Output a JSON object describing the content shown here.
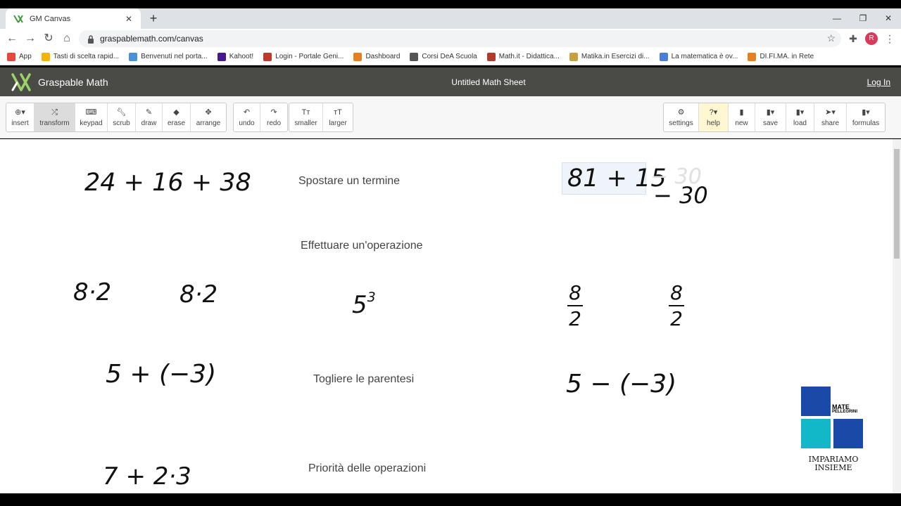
{
  "browser": {
    "tab_title": "GM Canvas",
    "url": "graspablemath.com/canvas",
    "avatar_letter": "R",
    "bookmarks": [
      "App",
      "Tasti di scelta rapid...",
      "Benvenuti nel porta...",
      "Kahoot!",
      "Login - Portale Geni...",
      "Dashboard",
      "Corsi DeA Scuola",
      "Math.it - Didattica...",
      "Matika.in Esercizi di...",
      "La matematica è ov...",
      "DI.FI.MA. in Rete"
    ]
  },
  "app": {
    "brand": "Graspable Math",
    "sheet_title": "Untitled Math Sheet",
    "login": "Log In"
  },
  "toolbar": {
    "left": [
      {
        "label": "insert",
        "icon": "plus-circle-icon"
      },
      {
        "label": "transform",
        "icon": "shuffle-icon",
        "active": true
      },
      {
        "label": "keypad",
        "icon": "keyboard-icon"
      },
      {
        "label": "scrub",
        "icon": "wrench-icon"
      },
      {
        "label": "draw",
        "icon": "pencil-icon"
      },
      {
        "label": "erase",
        "icon": "eraser-icon"
      },
      {
        "label": "arrange",
        "icon": "move-icon"
      }
    ],
    "history": [
      {
        "label": "undo",
        "icon": "undo-icon"
      },
      {
        "label": "redo",
        "icon": "redo-icon"
      }
    ],
    "size": [
      {
        "label": "smaller",
        "icon": "text-smaller-icon"
      },
      {
        "label": "larger",
        "icon": "text-larger-icon"
      }
    ],
    "right": [
      {
        "label": "settings",
        "icon": "gear-icon"
      },
      {
        "label": "help",
        "icon": "question-icon"
      },
      {
        "label": "new",
        "icon": "file-icon"
      },
      {
        "label": "save",
        "icon": "save-icon"
      },
      {
        "label": "load",
        "icon": "load-icon"
      },
      {
        "label": "share",
        "icon": "share-icon"
      },
      {
        "label": "formulas",
        "icon": "book-icon"
      }
    ]
  },
  "canvas": {
    "expr1": "24 + 16 + 38",
    "label_move": "Spostare un termine",
    "expr_moving": "81 + 15",
    "expr_moving_ghost": "− 30",
    "expr_moving_tail": "− 30",
    "label_operation": "Effettuare un'operazione",
    "expr_mult_a": "8·2",
    "expr_mult_b": "8·2",
    "expr_power_base": "5",
    "expr_power_exp": "3",
    "frac_a_num": "8",
    "frac_a_den": "2",
    "frac_b_num": "8",
    "frac_b_den": "2",
    "expr_paren_a": "5 + (−3)",
    "label_parens": "Togliere le parentesi",
    "expr_paren_b": "5 − (−3)",
    "expr_priority": "7 + 2·3",
    "label_priority": "Priorità delle operazioni"
  },
  "badge": {
    "line1": "MATE",
    "line2": "PELLEGRINI",
    "line3": "IMPARIAMO",
    "line4": "INSIEME",
    "colors": {
      "blue": "#1a4aa8",
      "cyan": "#12b8c8"
    }
  },
  "colors": {
    "header_bg": "#4a4a47",
    "toolbar_bg": "#f7f7f7",
    "active_tool": "#dcdcdc",
    "help_tool": "#fff6d2"
  }
}
